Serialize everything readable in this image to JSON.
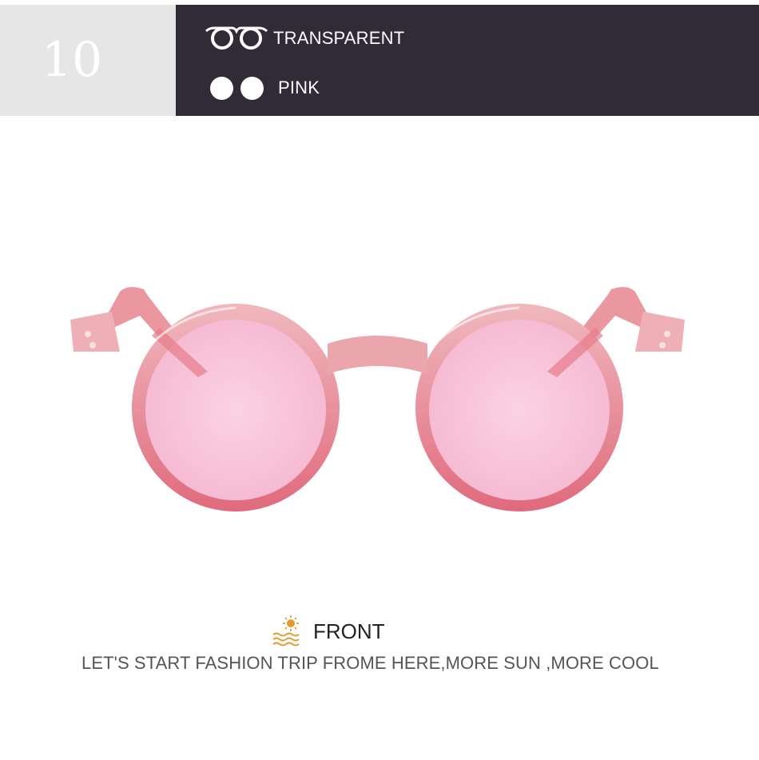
{
  "header": {
    "number": "10",
    "frame_icon": "glasses-frame-outline-icon",
    "frame_label": "TRANSPARENT",
    "lens_icon": "lens-circles-icon",
    "lens_label": "PINK"
  },
  "colors": {
    "number_box_bg": "#e6e6e6",
    "info_box_bg": "#302b37",
    "lens_pink": "#f8c4d8",
    "frame_pink": "#e88a9c"
  },
  "footer": {
    "icon": "sun-over-waves-icon",
    "view_label": "FRONT",
    "tagline": "LET'S START FASHION TRIP FROME HERE,MORE SUN ,MORE COOL"
  }
}
